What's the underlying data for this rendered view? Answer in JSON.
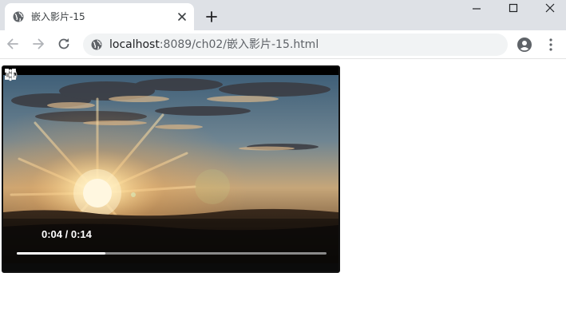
{
  "browser": {
    "tab": {
      "title": "嵌入影片-15"
    },
    "address": {
      "host": "localhost",
      "rest": ":8089/ch02/嵌入影片-15.html"
    }
  },
  "video": {
    "time_display": "0:04 / 0:14",
    "current_seconds": 4,
    "duration_seconds": 14,
    "state": "playing",
    "muted_icon_dimmed": true
  },
  "colors": {
    "tabstrip": "#dee1e6",
    "omnibox": "#f1f3f4",
    "sky_top": "#4f6f88",
    "sun": "#fff2c4"
  }
}
